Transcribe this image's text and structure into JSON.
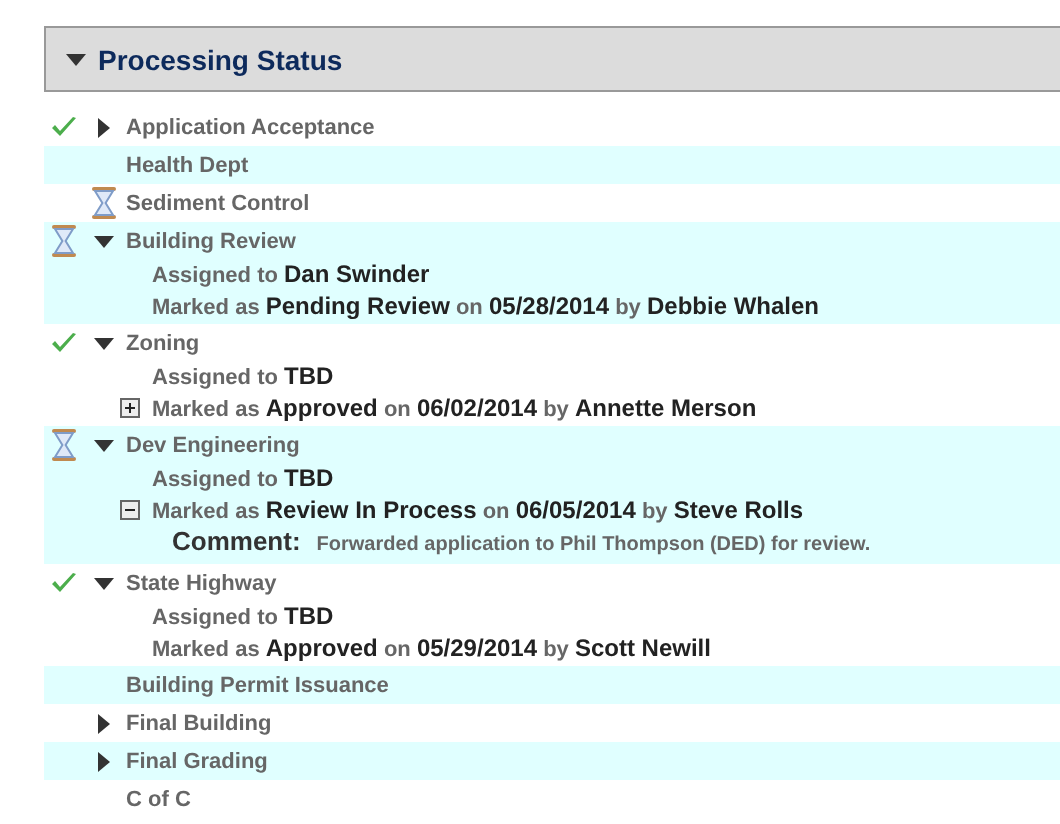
{
  "section": {
    "title": "Processing Status",
    "expanded": true
  },
  "items": [
    {
      "name": "Application Acceptance",
      "completed": true,
      "expanded": false
    },
    {
      "name": "Health Dept"
    },
    {
      "name": "Sediment Control",
      "completed": false
    },
    {
      "name": "Building Review",
      "completed": false,
      "expanded": true,
      "lines": [
        {
          "text": "Assigned to **Dan Swinder**"
        },
        {
          "text": "Marked as **Pending Review** on **05/28/2014** by **Debbie Whalen**"
        }
      ]
    },
    {
      "name": "Zoning",
      "completed": true,
      "expanded": true,
      "lines": [
        {
          "text": "Assigned to **TBD**"
        },
        {
          "text": "Marked as **Approved** on **06/02/2014** by **Annette Merson**",
          "expanded": false
        }
      ]
    },
    {
      "name": "Dev Engineering",
      "completed": false,
      "expanded": true,
      "lines": [
        {
          "text": "Assigned to **TBD**"
        },
        {
          "text": "Marked as **Review In Process** on **06/05/2014** by **Steve Rolls**",
          "expanded": true
        }
      ],
      "comment": {
        "label": "Comment:",
        "text": "Forwarded application to Phil Thompson (DED) for review."
      }
    },
    {
      "name": "State Highway",
      "completed": true,
      "expanded": true,
      "lines": [
        {
          "text": "Assigned to **TBD**"
        },
        {
          "text": "Marked as **Approved** on **05/29/2014** by **Scott Newill**"
        }
      ]
    },
    {
      "name": "Building Permit Issuance"
    },
    {
      "name": "Final Building",
      "expanded": false
    },
    {
      "name": "Final Grading",
      "expanded": false
    },
    {
      "name": "C of C"
    }
  ]
}
